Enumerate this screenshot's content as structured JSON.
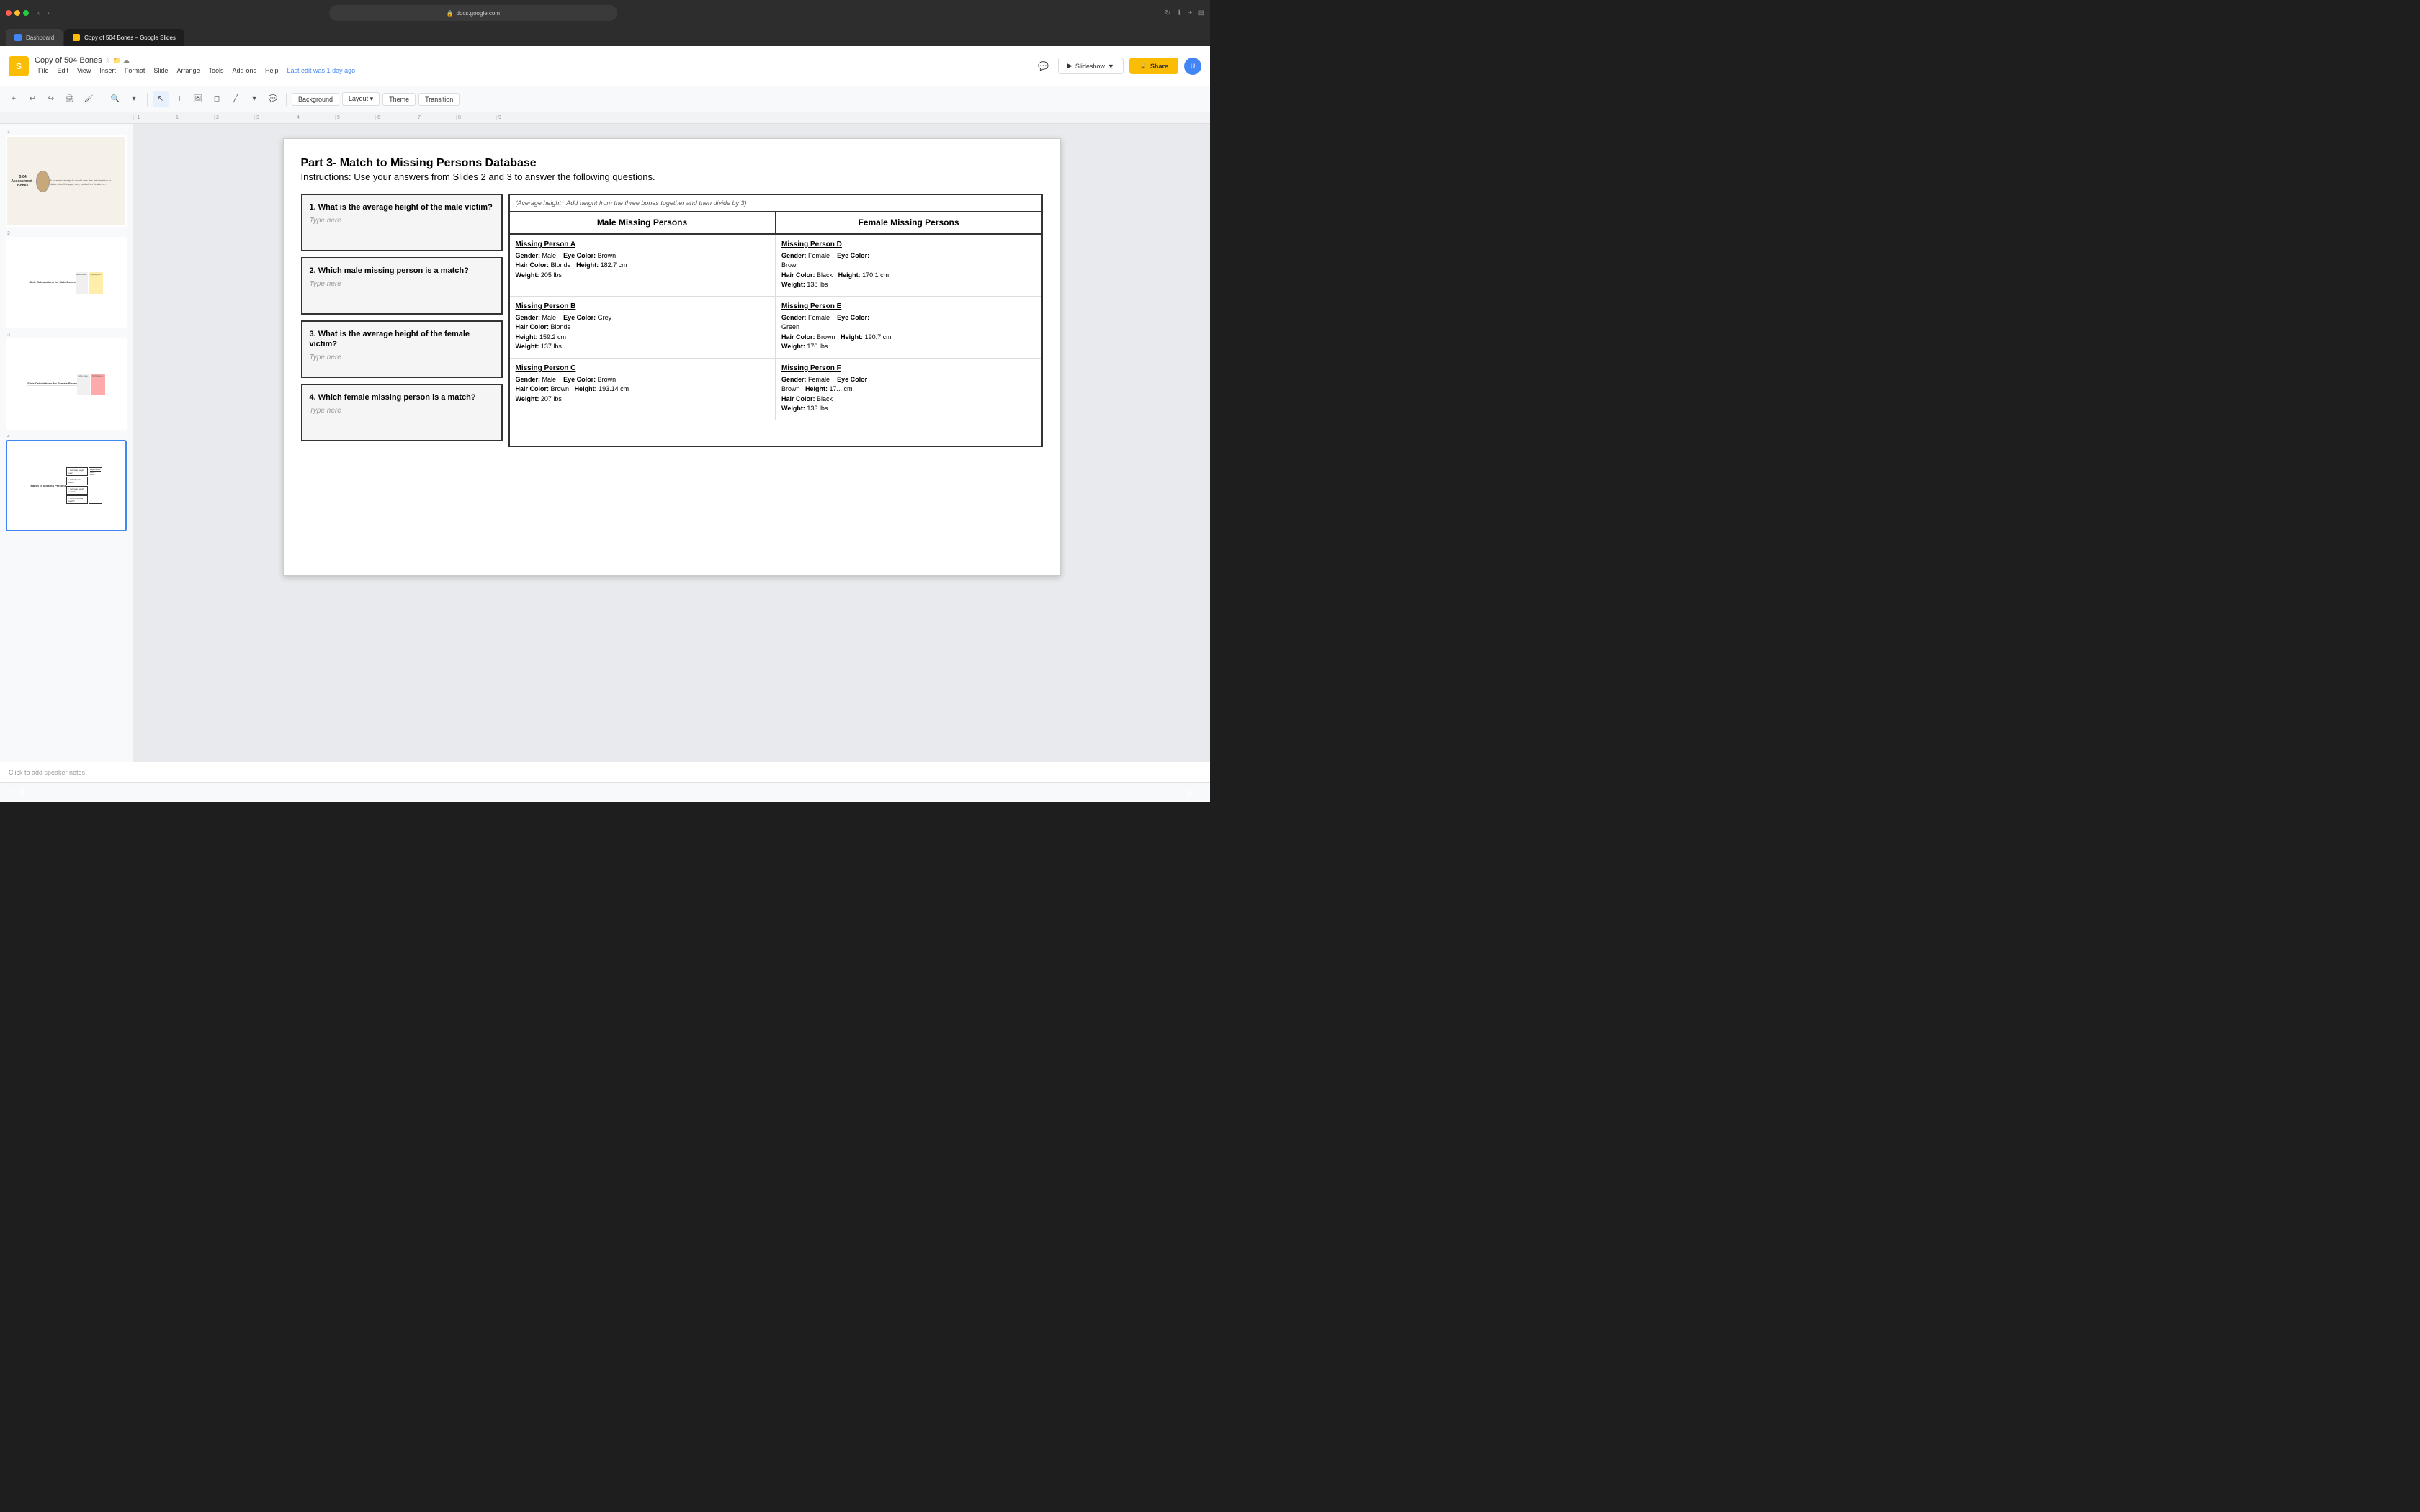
{
  "browser": {
    "address": "docs.google.com",
    "tabs": [
      {
        "label": "Dashboard",
        "icon": "dashboard",
        "active": false
      },
      {
        "label": "Copy of 504 Bones – Google Slides",
        "icon": "slides",
        "active": true
      }
    ]
  },
  "header": {
    "title": "Copy of 504 Bones",
    "last_edit": "Last edit was 1 day ago",
    "slideshow_label": "Slideshow",
    "share_label": "Share",
    "menu": [
      "File",
      "Edit",
      "View",
      "Insert",
      "Format",
      "Slide",
      "Arrange",
      "Tools",
      "Add-ons",
      "Help"
    ]
  },
  "toolbar": {
    "background_label": "Background",
    "layout_label": "Layout",
    "theme_label": "Theme",
    "transition_label": "Transition"
  },
  "slide": {
    "title": "Part 3- Match to Missing Persons Database",
    "instructions": "Instructions: Use your answers from Slides 2 and 3 to answer the following questions.",
    "hint": "(Average height= Add height from the three bones together and then divide by 3)",
    "questions": [
      {
        "num": "1.",
        "text": "What is the average height of the male victim?",
        "placeholder": "Type here"
      },
      {
        "num": "2.",
        "text": "Which male missing person is a match?",
        "placeholder": "Type here"
      },
      {
        "num": "3.",
        "text": "What is the average height of the female victim?",
        "placeholder": "Type here"
      },
      {
        "num": "4.",
        "text": "Which female missing person is a match?",
        "placeholder": "Type here"
      }
    ],
    "table_headers": [
      "Male Missing Persons",
      "Female Missing Persons"
    ],
    "persons": [
      {
        "male": {
          "name": "Missing Person A",
          "gender": "Male",
          "eye_color": "Brown",
          "hair_color": "Blonde",
          "height": "182.7 cm",
          "weight": "205 lbs"
        },
        "female": {
          "name": "Missing Person D",
          "gender": "Female",
          "eye_color": "Brown",
          "hair_color": "Black",
          "height": "170.1 cm",
          "weight": "138 lbs"
        }
      },
      {
        "male": {
          "name": "Missing Person B",
          "gender": "Male",
          "eye_color": "Grey",
          "hair_color": "Blonde",
          "height": "159.2 cm",
          "weight": "137 lbs"
        },
        "female": {
          "name": "Missing Person E",
          "gender": "Female",
          "eye_color": "Green",
          "hair_color": "Brown",
          "height": "190.7 cm",
          "weight": "170 lbs"
        }
      },
      {
        "male": {
          "name": "Missing Person C",
          "gender": "Male",
          "eye_color": "Brown",
          "hair_color": "Brown",
          "height": "193.14 cm",
          "weight": "207 lbs"
        },
        "female": {
          "name": "Missing Person F",
          "gender": "Female",
          "eye_color": "Brown",
          "hair_color": "Black",
          "height": "17... cm",
          "weight": "133 lbs"
        }
      }
    ]
  },
  "sidebar": {
    "slides": [
      {
        "num": "1",
        "label": "Slide 1"
      },
      {
        "num": "2",
        "label": "Slide 2"
      },
      {
        "num": "3",
        "label": "Slide 3"
      },
      {
        "num": "4",
        "label": "Slide 4",
        "active": true
      }
    ]
  },
  "speaker_notes": {
    "placeholder": "Click to add speaker notes"
  },
  "ruler": {
    "marks": [
      "-1",
      "1",
      "2",
      "3",
      "4",
      "5",
      "6",
      "7",
      "8",
      "9"
    ]
  }
}
